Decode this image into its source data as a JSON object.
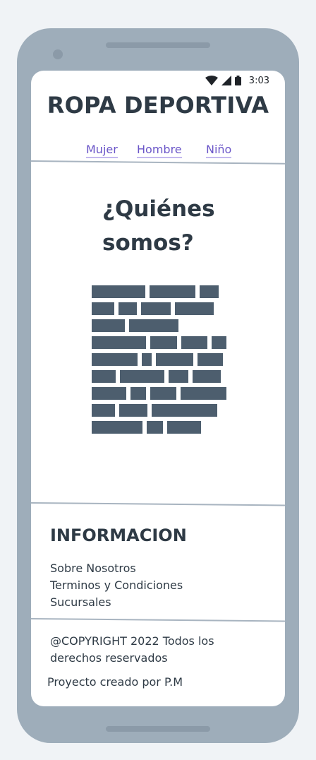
{
  "status": {
    "time": "3:03",
    "icons": [
      "wifi-icon",
      "signal-icon",
      "battery-icon"
    ]
  },
  "header": {
    "title": "ROPA DEPORTIVA",
    "nav": [
      "Mujer",
      "Hombre",
      "Niño"
    ]
  },
  "main": {
    "heading_line1": "¿Quiénes",
    "heading_line2": "somos?",
    "image_icon": "brick-wall-icon"
  },
  "footer": {
    "info_title": "INFORMACION",
    "links": [
      "Sobre Nosotros",
      "Terminos y Condiciones",
      "Sucursales"
    ],
    "copyright": "@COPYRIGHT 2022 Todos los derechos reservados",
    "credit": "Proyecto creado por P.M"
  },
  "colors": {
    "phone_body": "#9eadba",
    "text_dark": "#2e3a45",
    "link": "#6a55c8",
    "brick": "#4d5e6e"
  }
}
